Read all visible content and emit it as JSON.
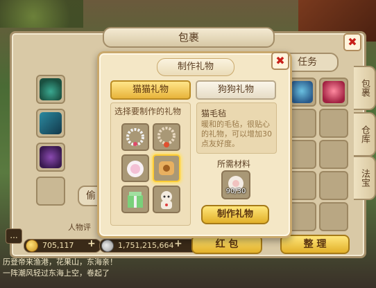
{
  "bag": {
    "title": "包裹",
    "close_label": "✖",
    "tab_task": "任务",
    "side_tabs": [
      "包裹",
      "仓库",
      "法宝"
    ],
    "character_label": "人物评",
    "hidden_left_label": "偷"
  },
  "currency": {
    "gold": "705,117",
    "silver": "1,751,215,664",
    "add_label": "+"
  },
  "bottom_buttons": {
    "red_packet": "红 包",
    "sort": "整 理"
  },
  "chat": {
    "line1": "历登帝来渔港，花果山，东海亲！",
    "line2": "一阵潮风轻过东海上空，卷起了",
    "icon": "..."
  },
  "craft": {
    "title": "制作礼物",
    "close_label": "✖",
    "tabs": [
      "猫猫礼物",
      "狗狗礼物"
    ],
    "list_label": "选择要制作的礼物",
    "item": {
      "name": "猫毛毡",
      "description": "暖和的毛毡，很贴心的礼物，可以增加30点友好度。"
    },
    "materials_label": "所需材料",
    "material_count": "90/30",
    "make_button": "制作礼物",
    "gifts": [
      {
        "icon": "bead-bracelet-icon"
      },
      {
        "icon": "bead-necklace-icon"
      },
      {
        "icon": "pink-pompom-icon"
      },
      {
        "icon": "felt-scroll-icon",
        "selected": true
      },
      {
        "icon": "gift-box-icon"
      },
      {
        "icon": "lucky-cat-icon"
      }
    ]
  }
}
